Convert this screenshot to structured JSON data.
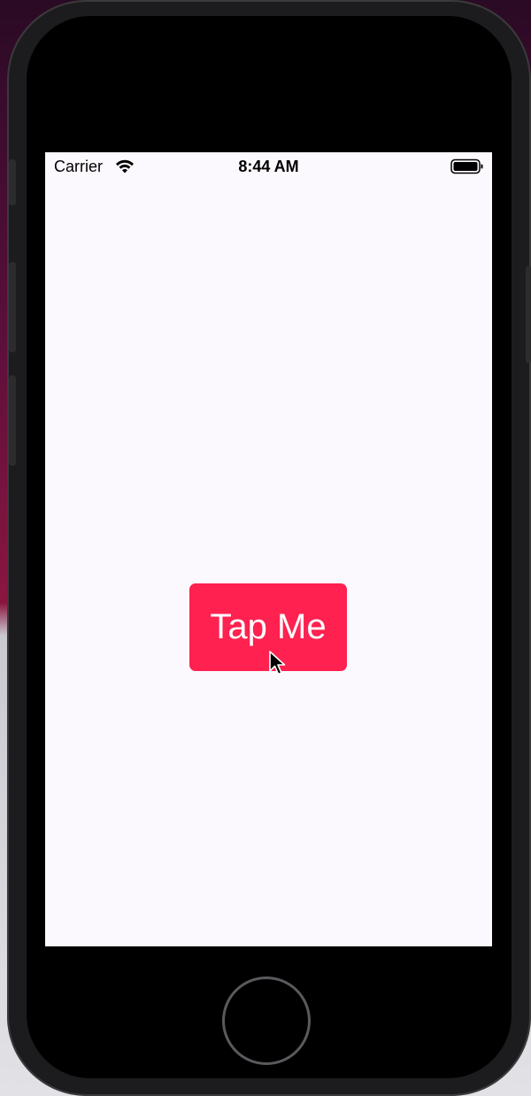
{
  "status_bar": {
    "carrier": "Carrier",
    "time": "8:44 AM",
    "wifi_icon": "wifi-icon",
    "battery_icon": "battery-full-icon"
  },
  "main": {
    "button_label": "Tap Me",
    "button_color": "#ff2150",
    "background_color": "#fbf9fd"
  },
  "device": {
    "home_button_icon": "home-button",
    "cursor_icon": "mouse-pointer-icon"
  }
}
